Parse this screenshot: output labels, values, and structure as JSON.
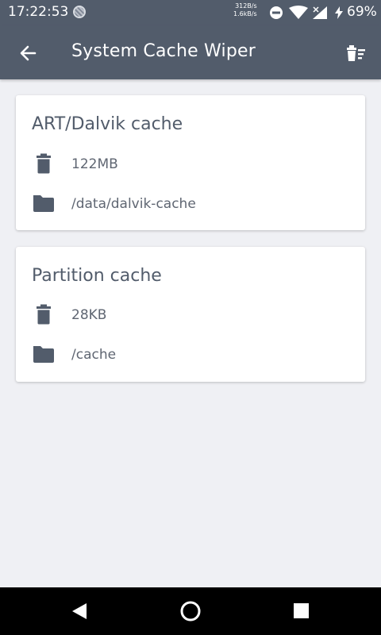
{
  "status_bar": {
    "time": "17:22:53",
    "net_up": "312B/s",
    "net_down": "1.6kB/s",
    "battery": "69%"
  },
  "app_bar": {
    "title": "System Cache Wiper"
  },
  "caches": [
    {
      "title": "ART/Dalvik cache",
      "size": "122MB",
      "path": "/data/dalvik-cache"
    },
    {
      "title": "Partition cache",
      "size": "28KB",
      "path": "/cache"
    }
  ],
  "colors": {
    "app_bar": "#525c6b",
    "background": "#eff0f4",
    "card": "#ffffff",
    "text": "#525c6b"
  },
  "icons": {
    "back": "arrow-left-icon",
    "wipe": "delete-sweep-icon",
    "size": "trash-icon",
    "path": "folder-icon",
    "nav_back": "triangle-back-icon",
    "nav_home": "circle-home-icon",
    "nav_recents": "square-recents-icon"
  }
}
